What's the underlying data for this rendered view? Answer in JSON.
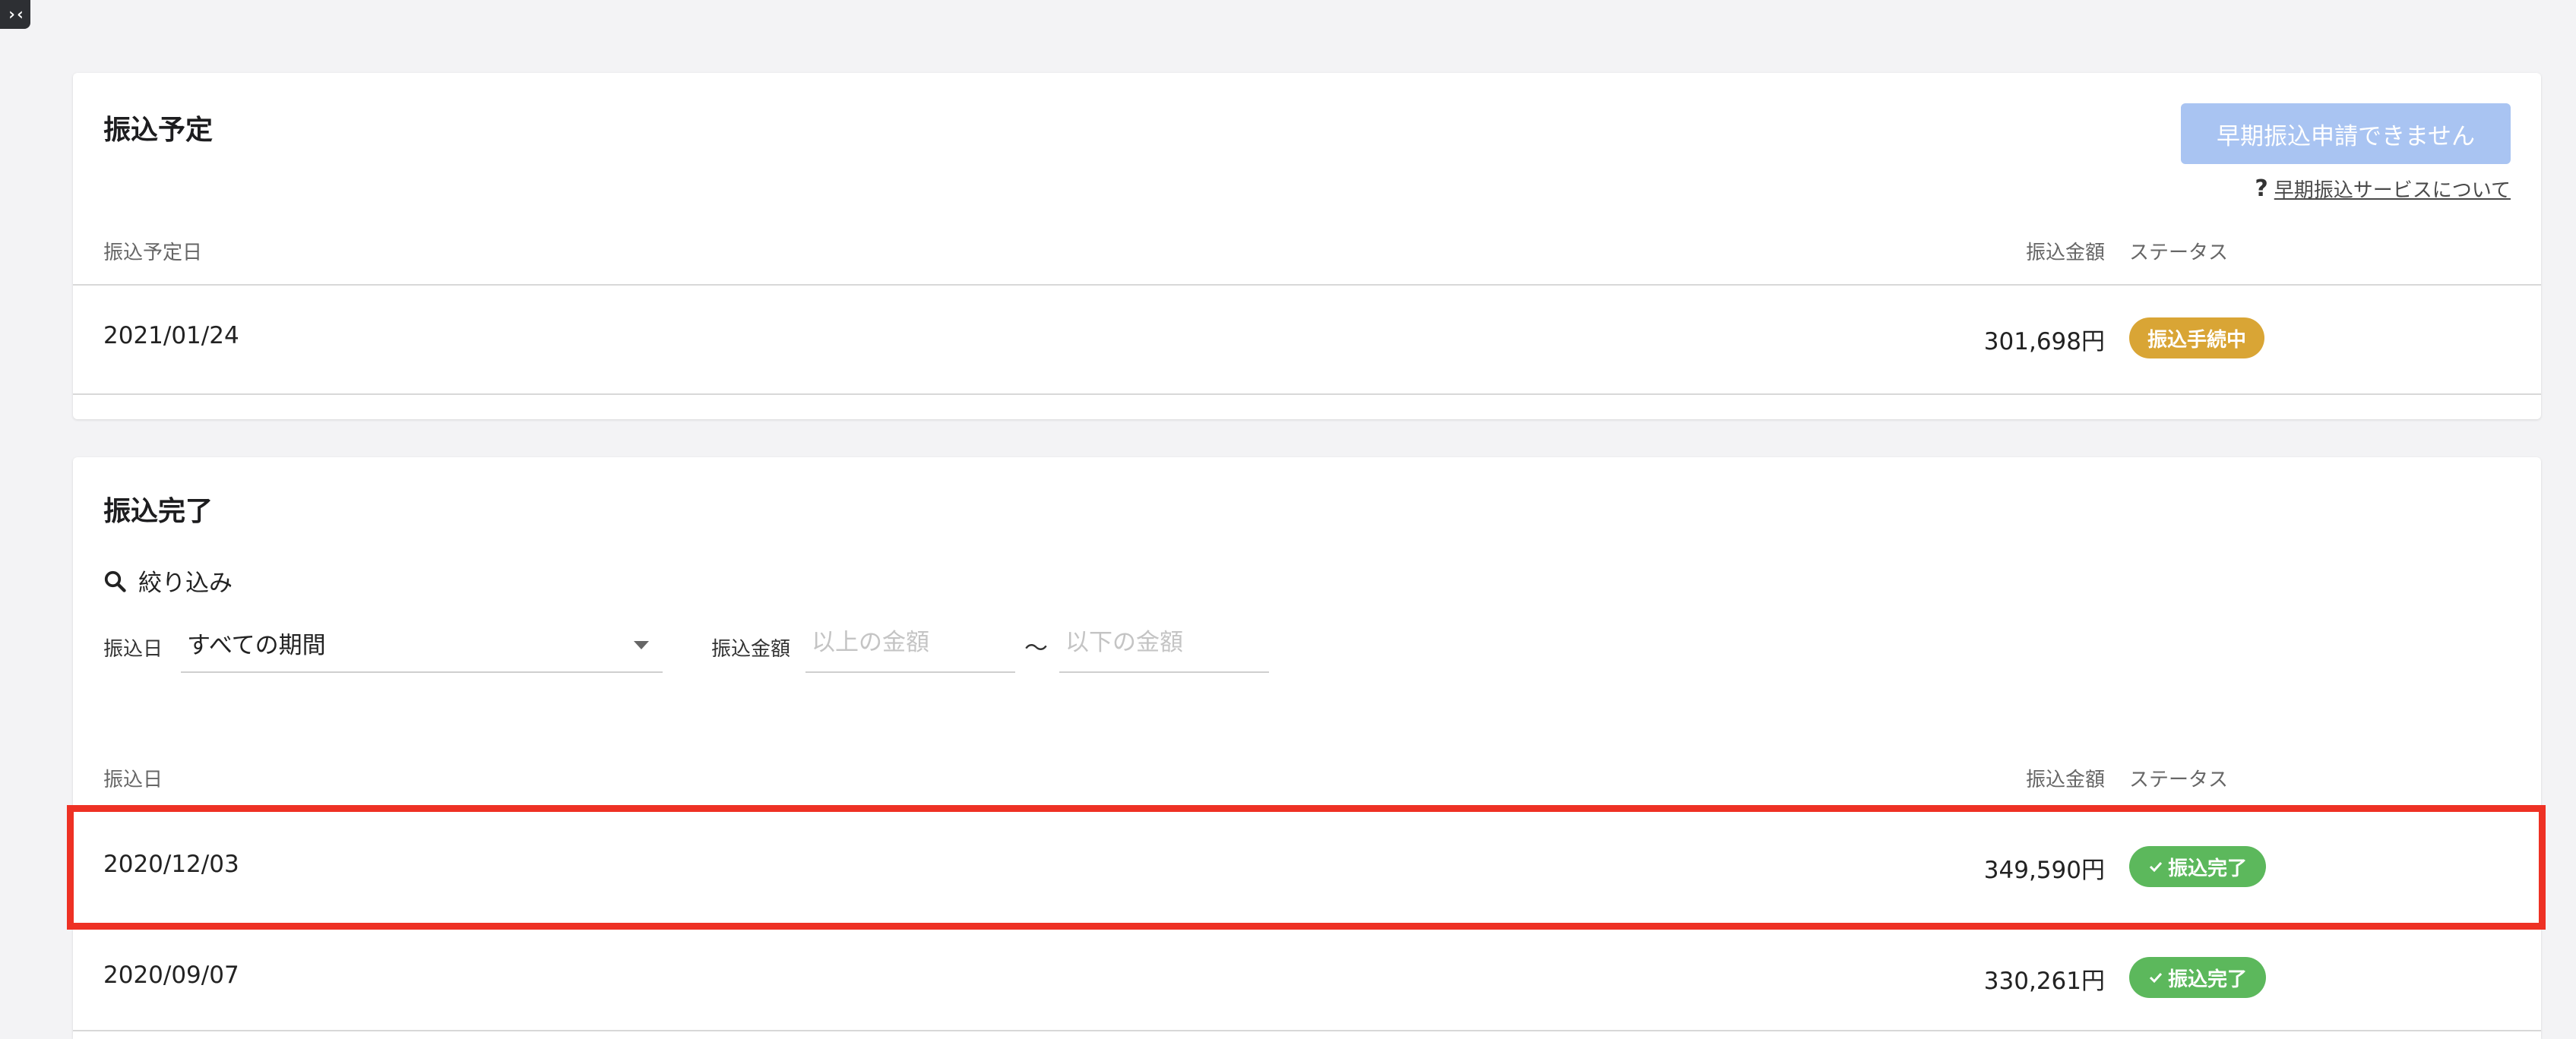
{
  "toggle": {
    "label": "›‹"
  },
  "schedule": {
    "title": "振込予定",
    "early_button": "早期振込申請できません",
    "help_icon": "?",
    "help_link": "早期振込サービスについて",
    "headers": {
      "date": "振込予定日",
      "amount": "振込金額",
      "status": "ステータス"
    },
    "rows": [
      {
        "date": "2021/01/24",
        "amount": "301,698円",
        "status": "振込手続中"
      }
    ]
  },
  "completed": {
    "title": "振込完了",
    "filter": {
      "heading": "絞り込み",
      "date_label": "振込日",
      "period_value": "すべての期間",
      "amount_label": "振込金額",
      "min_placeholder": "以上の金額",
      "tilde": "〜",
      "max_placeholder": "以下の金額"
    },
    "headers": {
      "date": "振込日",
      "amount": "振込金額",
      "status": "ステータス"
    },
    "rows": [
      {
        "date": "2020/12/03",
        "amount": "349,590円",
        "status": "振込完了",
        "highlighted": true
      },
      {
        "date": "2020/09/07",
        "amount": "330,261円",
        "status": "振込完了"
      }
    ]
  },
  "colors": {
    "processing_badge": "#d9a535",
    "done_badge": "#5cb85c",
    "disabled_button": "#a9c4f2",
    "highlight_border": "#ee3124"
  }
}
